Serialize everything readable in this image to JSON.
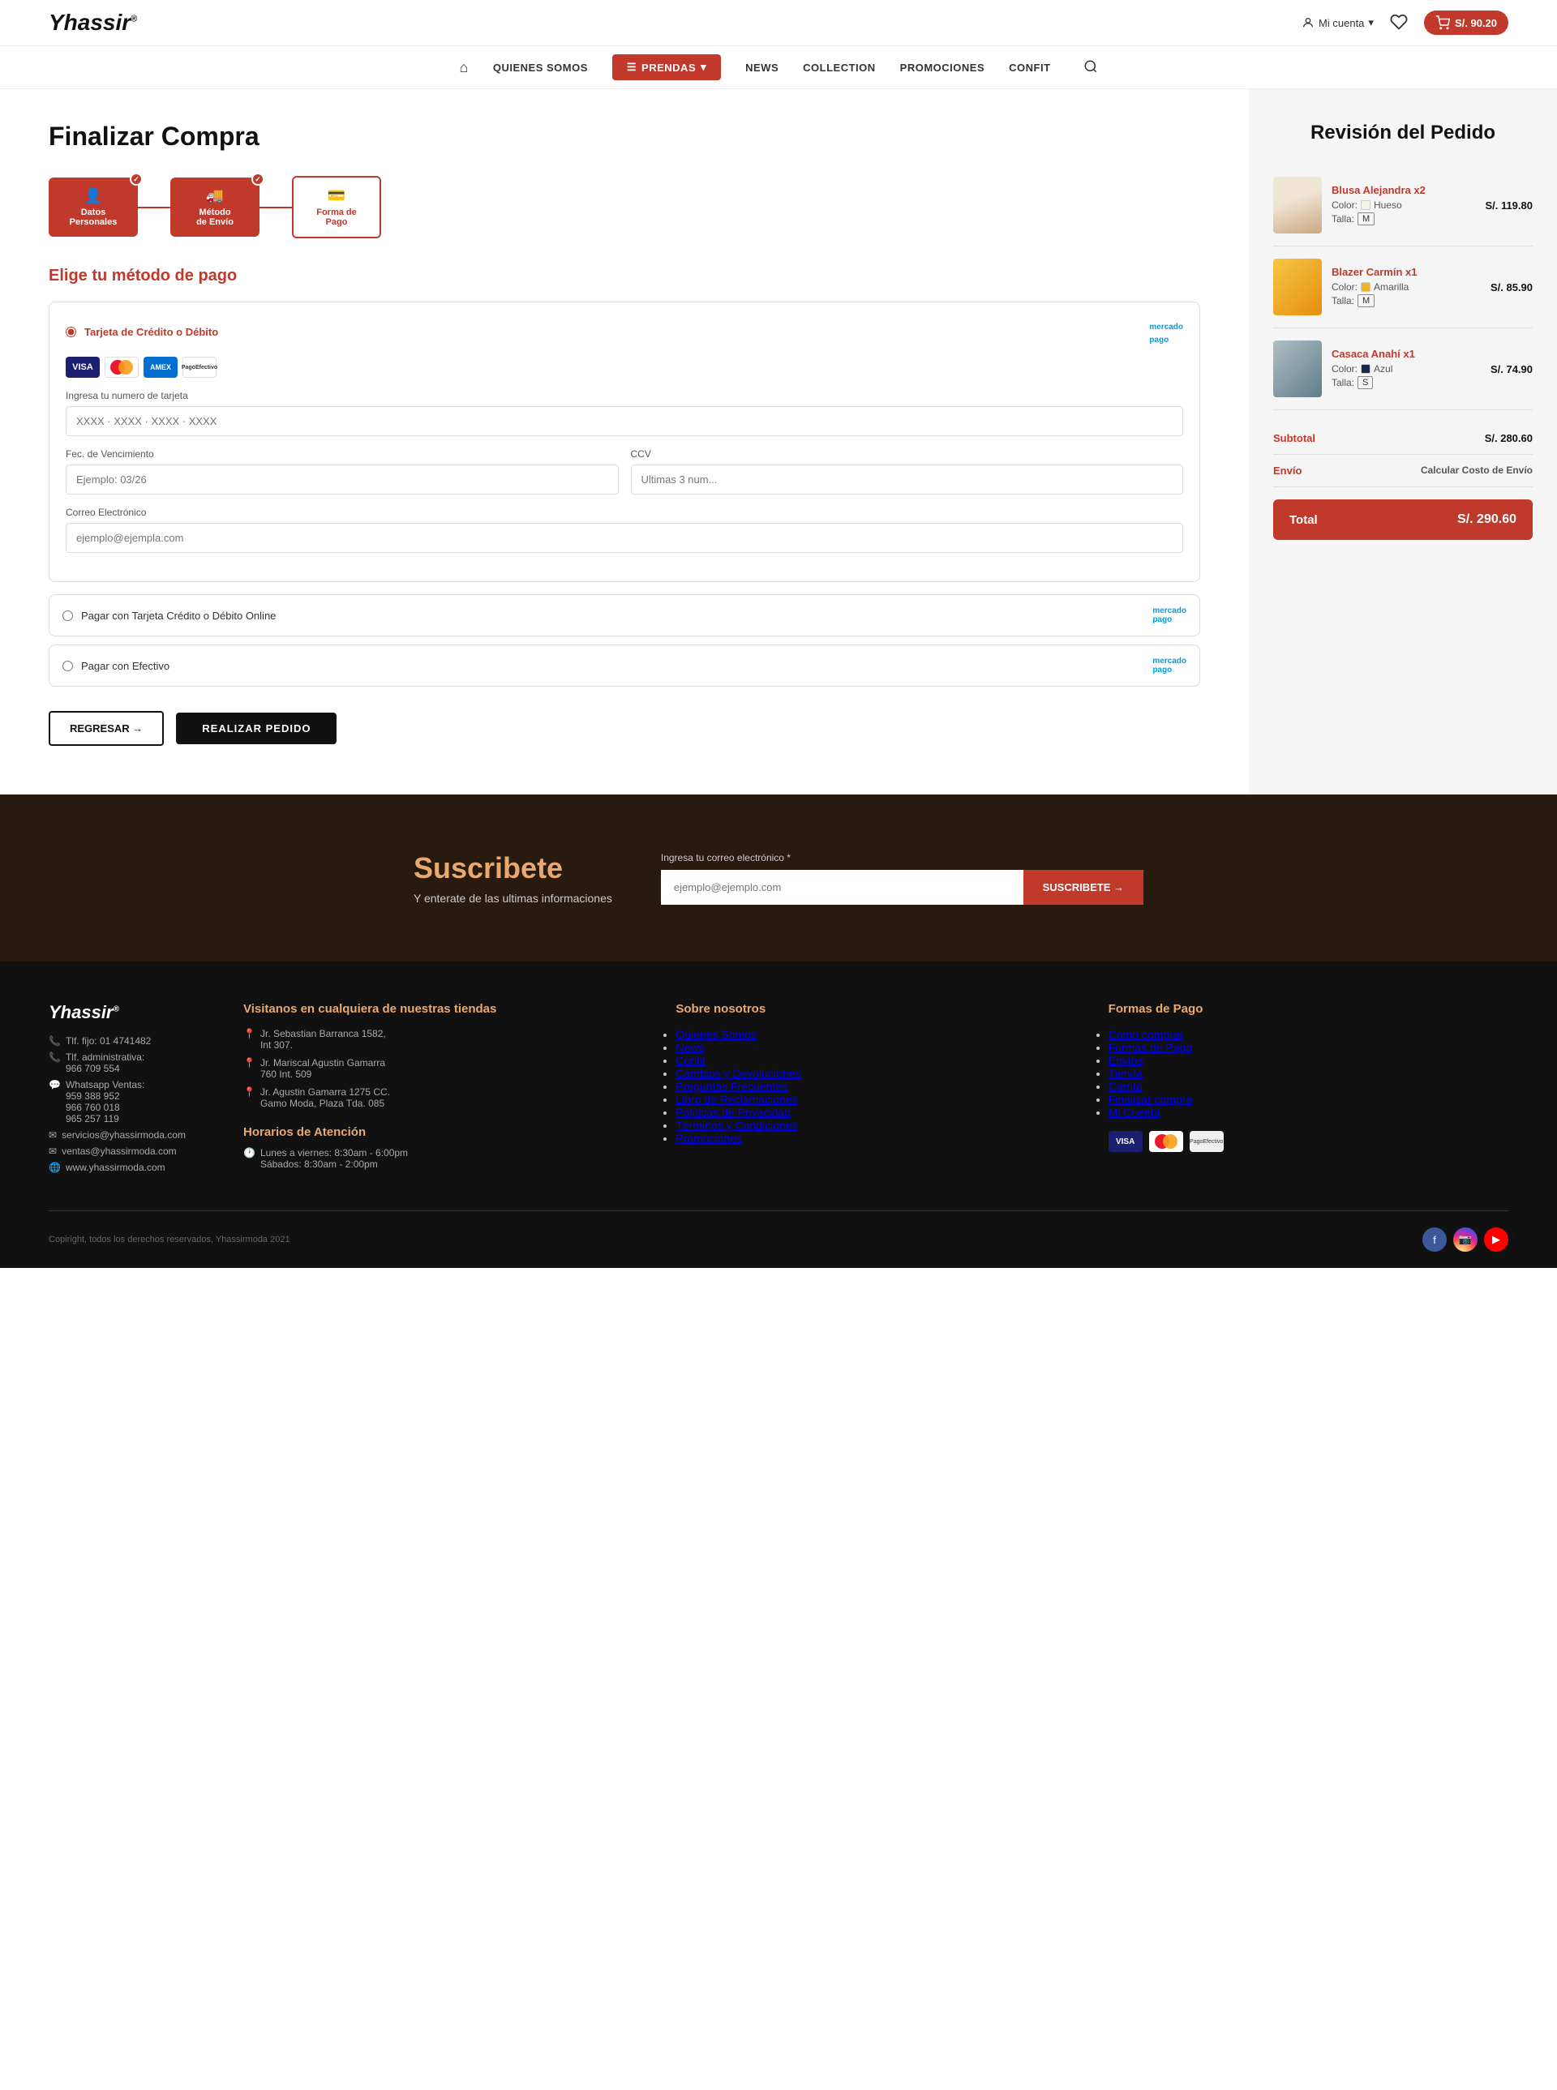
{
  "header": {
    "logo": "Yhassir",
    "logo_trademark": "®",
    "mi_cuenta": "Mi cuenta",
    "cart_price": "S/. 90.20"
  },
  "nav": {
    "home": "⌂",
    "quienes_somos": "QUIENES SOMOS",
    "prendas": "PRENDAS",
    "news": "NEWS",
    "collection": "COLLECTION",
    "promociones": "PROMOCIONES",
    "confit": "CONFIT"
  },
  "checkout": {
    "title": "Finalizar Compra",
    "steps": [
      {
        "label": "Datos",
        "sublabel": "Personales",
        "icon": "👤",
        "active": true
      },
      {
        "label": "Método",
        "sublabel": "de Envío",
        "icon": "🚚",
        "active": true
      },
      {
        "label": "Forma de",
        "sublabel": "Pago",
        "icon": "💳",
        "active": false
      }
    ],
    "payment_section_title": "Elige tu método de pago",
    "payment_methods": [
      {
        "id": "credit_card",
        "label": "Tarjeta de Crédito o Débito",
        "selected": true,
        "card_input_placeholder": "XXXX · XXXX · XXXX · XXXX",
        "card_number_label": "Ingresa tu numero de tarjeta",
        "expiry_label": "Fec. de Vencimiento",
        "expiry_placeholder": "Ejemplo: 03/26",
        "ccv_label": "CCV",
        "ccv_placeholder": "Ultimas 3 num...",
        "email_label": "Correo Electrónico",
        "email_placeholder": "ejemplo@ejempla.com"
      },
      {
        "id": "credit_online",
        "label": "Pagar con Tarjeta Crédito o Débito Online",
        "selected": false
      },
      {
        "id": "efectivo",
        "label": "Pagar con Efectivo",
        "selected": false
      }
    ],
    "btn_back": "REGRESAR →",
    "btn_order": "REALIZAR PEDIDO"
  },
  "order_review": {
    "title": "Revisión del Pedido",
    "items": [
      {
        "name": "Blusa Alejandra x2",
        "color_label": "Color:",
        "color_name": "Hueso",
        "color_hex": "#f5f0e8",
        "size_label": "Talla:",
        "size": "M",
        "price": "S/. 119.80"
      },
      {
        "name": "Blazer Carmín x1",
        "color_label": "Color:",
        "color_name": "Amarilla",
        "color_hex": "#f0b429",
        "size_label": "Talla:",
        "size": "M",
        "price": "S/. 85.90"
      },
      {
        "name": "Casaca Anahí  x1",
        "color_label": "Color:",
        "color_name": "Azul",
        "color_hex": "#1a2a4a",
        "size_label": "Talla:",
        "size": "S",
        "price": "S/. 74.90"
      }
    ],
    "subtotal_label": "Subtotal",
    "subtotal_value": "S/. 280.60",
    "shipping_label": "Envío",
    "shipping_value": "Calcular Costo de Envío",
    "total_label": "Total",
    "total_value": "S/. 290.60"
  },
  "subscribe": {
    "title": "Suscribete",
    "subtitle": "Y enterate de las ultimas informaciones",
    "input_label": "Ingresa tu correo electrónico *",
    "input_placeholder": "ejemplo@ejemplo.com",
    "button": "SUSCRIBETE →"
  },
  "footer": {
    "logo": "Yhassir",
    "contact": [
      {
        "icon": "📞",
        "text": "Tlf. fijo: 01 4741482"
      },
      {
        "icon": "📞",
        "text": "Tlf. administrativa: 966 709 554"
      },
      {
        "icon": "💬",
        "text": "Whatsapp Ventas: 959 388 952  966 760 018  965 257 119"
      },
      {
        "icon": "✉",
        "text": "servicios@yhassirmoda.com"
      },
      {
        "icon": "✉",
        "text": "ventas@yhassirmoda.com"
      },
      {
        "icon": "🌐",
        "text": "www.yhassirmoda.com"
      }
    ],
    "stores_title": "Visitanos en cualquiera de nuestras tiendas",
    "stores": [
      {
        "icon": "📍",
        "text": "Jr. Sebastian Barranca 1582, Int 307."
      },
      {
        "icon": "📍",
        "text": "Jr. Mariscal Agustin Gamarra 760 Int. 509"
      },
      {
        "icon": "📍",
        "text": "Jr. Agustin Gamarra 1275 CC. Gamo Moda, Plaza Tda. 085"
      }
    ],
    "hours_title": "Horarios de Atención",
    "hours": [
      {
        "icon": "🕐",
        "text": "Lunes a viernes: 8:30am - 6:00pm  Sábados: 8:30am - 2:00pm"
      }
    ],
    "about_title": "Sobre nosotros",
    "about_links": [
      "Quienes Somos",
      "News",
      "Confit",
      "Cambios y Devoluciones",
      "Preguntas Frecuentes",
      "Libro de Reclamaciones",
      "Políticas de Privacidad",
      "Términos y Condiciones",
      "Promociones"
    ],
    "payment_title": "Formas de Pago",
    "payment_links": [
      "Como comprar",
      "Formas de Pago",
      "Envíos",
      "Tienda",
      "Carrito",
      "Finalizar compra",
      "Mi Cuenta"
    ],
    "copyright": "Copiright, todos los derechos reservados, Yhassirmoda 2021"
  }
}
